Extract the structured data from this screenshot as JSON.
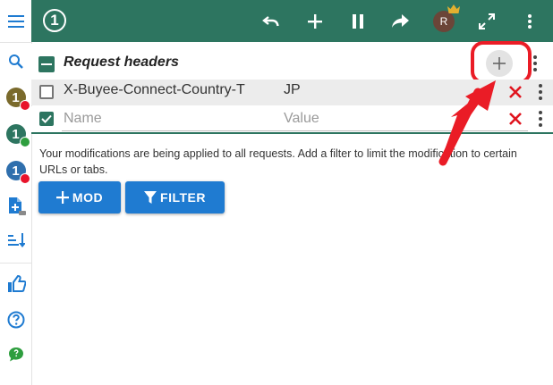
{
  "profiles": [
    {
      "num": "1",
      "color": "#7a6a2c",
      "badge": "#e8132b"
    },
    {
      "num": "1",
      "color": "#2d7560",
      "badge": "#2e9e3e"
    },
    {
      "num": "1",
      "color": "#2f6fad",
      "badge": "#e8132b"
    }
  ],
  "topbar": {
    "profile_number": "1",
    "avatar_letter": "R"
  },
  "section": {
    "title": "Request headers"
  },
  "headers": [
    {
      "name": "X-Buyee-Connect-Country-T",
      "value": "JP",
      "enabled": false
    },
    {
      "name": "",
      "value": "",
      "enabled": true,
      "name_placeholder": "Name",
      "value_placeholder": "Value"
    }
  ],
  "info_text": "Your modifications are being applied to all requests. Add a filter to limit the modification to certain URLs or tabs.",
  "buttons": {
    "mod_label": "MOD",
    "filter_label": "FILTER"
  },
  "icons": {
    "rail": [
      "menu-icon",
      "search-icon",
      "profile-badge",
      "profile-badge",
      "profile-badge",
      "add-file-icon",
      "sort-icon",
      "thumbs-up-icon",
      "help-icon",
      "feedback-icon"
    ],
    "topbar": [
      "profile-number",
      "undo-icon",
      "plus-icon",
      "pause-icon",
      "share-icon",
      "avatar",
      "crown-icon",
      "expand-icon",
      "more-vert-icon"
    ]
  },
  "colors": {
    "brand": "#2d7560",
    "accent": "#1f7bd1",
    "delete": "#e0141e",
    "annotation": "#ea1c26"
  }
}
